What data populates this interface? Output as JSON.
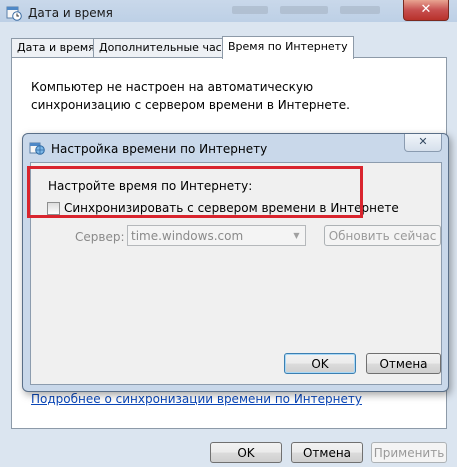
{
  "window": {
    "title": "Дата и время",
    "close_glyph": "✕",
    "icon": "clock-calendar-icon"
  },
  "tabs": [
    {
      "label": "Дата и время"
    },
    {
      "label": "Дополнительные часы"
    },
    {
      "label": "Время по Интернету",
      "active": true
    }
  ],
  "internet_time_tab": {
    "info_text": "Компьютер не настроен на автоматическую синхронизацию с сервером времени в Интернете.",
    "learn_more_link": "Подробнее о синхронизации времени по Интернету"
  },
  "dialog": {
    "title": "Настройка времени по Интернету",
    "close_glyph": "✕",
    "icon": "clock-globe-icon",
    "configure_label": "Настройте время по Интернету:",
    "sync_checkbox_label": "Синхронизировать с сервером времени в Интернете",
    "sync_checked": false,
    "server_label": "Сервер:",
    "server_value": "time.windows.com",
    "update_now_button": "Обновить сейчас",
    "ok_button": "OK",
    "cancel_button": "Отмена",
    "highlight_color": "#d9252e"
  },
  "footer": {
    "ok_button": "OK",
    "cancel_button": "Отмена",
    "apply_button": "Применить"
  }
}
